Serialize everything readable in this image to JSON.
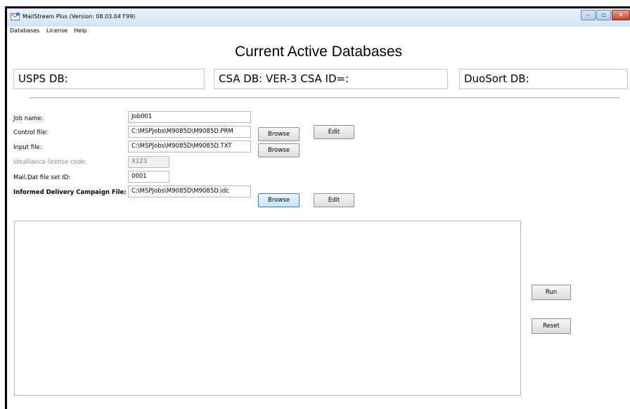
{
  "window": {
    "title": "MailStream Plus (Version: 08.03.04 F99)",
    "minimize_glyph": "–",
    "maximize_glyph": "▫",
    "close_glyph": "✕"
  },
  "menu": {
    "items": [
      {
        "label": "Databases"
      },
      {
        "label": "License"
      },
      {
        "label": "Help"
      }
    ]
  },
  "databases": {
    "heading": "Current Active Databases",
    "usps": "USPS DB:",
    "csa": "CSA DB: VER-3 CSA ID=:",
    "duosort": "DuoSort DB:"
  },
  "form": {
    "job_name": {
      "label": "Job name:",
      "value": "Job001"
    },
    "control_file": {
      "label": "Control file:",
      "value": "C:\\MSPJobs\\M9085D\\M9085D.PRM"
    },
    "input_file": {
      "label": "Input file:",
      "value": "C:\\MSPJobs\\M9085D\\M9085D.TXT"
    },
    "idealliance": {
      "label": "Idealliance license code:",
      "value": "X123"
    },
    "maildat": {
      "label": "Mail.Dat file set ID:",
      "value": "0001"
    },
    "campaign_file": {
      "label": "Informed Delivery Campaign File:",
      "value": "C:\\MSPJobs\\M9085D\\M9085D.idc"
    }
  },
  "buttons": {
    "browse": "Browse",
    "edit": "Edit",
    "run": "Run",
    "reset": "Reset"
  },
  "colors": {
    "titlebar": "#d3e3f4",
    "focus_border": "#3c7fb1"
  },
  "icons": {
    "app": "mail-envelope-icon"
  }
}
